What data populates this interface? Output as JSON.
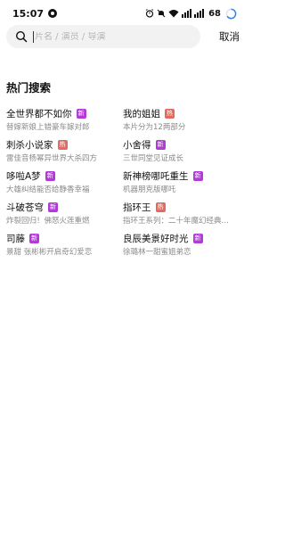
{
  "status_bar": {
    "time": "15:07",
    "battery": "68"
  },
  "search": {
    "placeholder": "片名 / 演员 / 导演",
    "cancel_label": "取消"
  },
  "section_title": "热门搜索",
  "badge_colors": {
    "新": "#b03bd6",
    "热": "#e26b5f"
  },
  "hot_items": [
    {
      "title": "全世界都不如你",
      "badge": "新",
      "badge_type": "new",
      "sub": "替嫁新娘上错豪车嫁对郎"
    },
    {
      "title": "我的姐姐",
      "badge": "热",
      "badge_type": "hot",
      "sub": "本片分为12两部分"
    },
    {
      "title": "刺杀小说家",
      "badge": "热",
      "badge_type": "hot",
      "sub": "雷佳音杨幂异世界大杀四方"
    },
    {
      "title": "小舍得",
      "badge": "新",
      "badge_type": "new",
      "sub": "三世同堂见证成长"
    },
    {
      "title": "哆啦A梦",
      "badge": "新",
      "badge_type": "new",
      "sub": "大雄纠结能否给静香幸福"
    },
    {
      "title": "新神榜哪吒重生",
      "badge": "新",
      "badge_type": "new",
      "sub": "机器朋克版哪吒"
    },
    {
      "title": "斗破苍穹",
      "badge": "新",
      "badge_type": "new",
      "sub": "炸裂回归！佛怒火莲重燃"
    },
    {
      "title": "指环王",
      "badge": "热",
      "badge_type": "hot",
      "sub": "指环王系列：二十年魔幻经典，…"
    },
    {
      "title": "司藤",
      "badge": "新",
      "badge_type": "new",
      "sub": "景甜 张彬彬开启奇幻爱恋"
    },
    {
      "title": "良辰美景好时光",
      "badge": "新",
      "badge_type": "new",
      "sub": "徐璐林一甜蜜姐弟恋"
    }
  ]
}
